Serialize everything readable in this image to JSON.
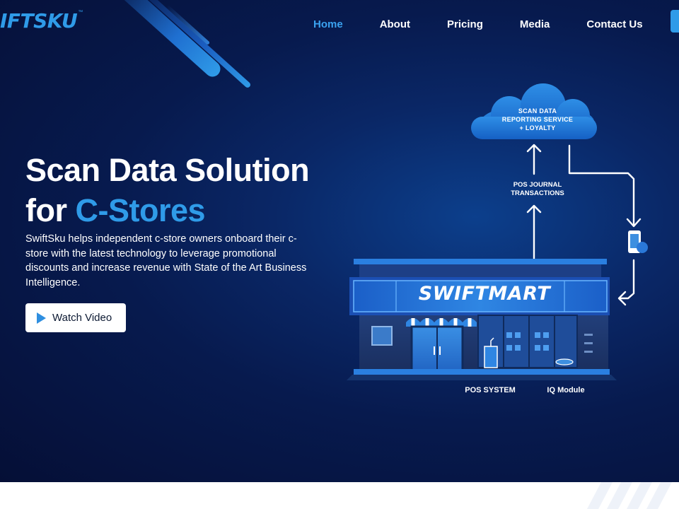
{
  "brand": {
    "logo_text": "IFTSKU",
    "trademark": "™"
  },
  "nav": {
    "items": [
      {
        "label": "Home",
        "active": true
      },
      {
        "label": "About",
        "active": false
      },
      {
        "label": "Pricing",
        "active": false
      },
      {
        "label": "Media",
        "active": false
      },
      {
        "label": "Contact Us",
        "active": false
      }
    ]
  },
  "hero": {
    "title_line1": "Scan Data Solution",
    "title_line2_prefix": "for ",
    "title_line2_accent": "C-Stores",
    "description": "SwiftSku helps independent c-store owners onboard their c-store with the latest technology to leverage promotional discounts and increase revenue with State of the Art Business Intelligence.",
    "cta_label": "Watch Video",
    "cta_icon": "play-icon"
  },
  "illustration": {
    "cloud_line1": "SCAN DATA",
    "cloud_line2": "REPORTING SERVICE",
    "cloud_line3": "+ LOYALTY",
    "pos_journal_line1": "POS JOURNAL",
    "pos_journal_line2": "TRANSACTIONS",
    "store_name": "SWIFTMART",
    "pos_system_label": "POS SYSTEM",
    "iq_module_label": "IQ Module"
  },
  "colors": {
    "accent": "#2f9be8",
    "background_dark": "#071a4e",
    "white": "#ffffff"
  }
}
